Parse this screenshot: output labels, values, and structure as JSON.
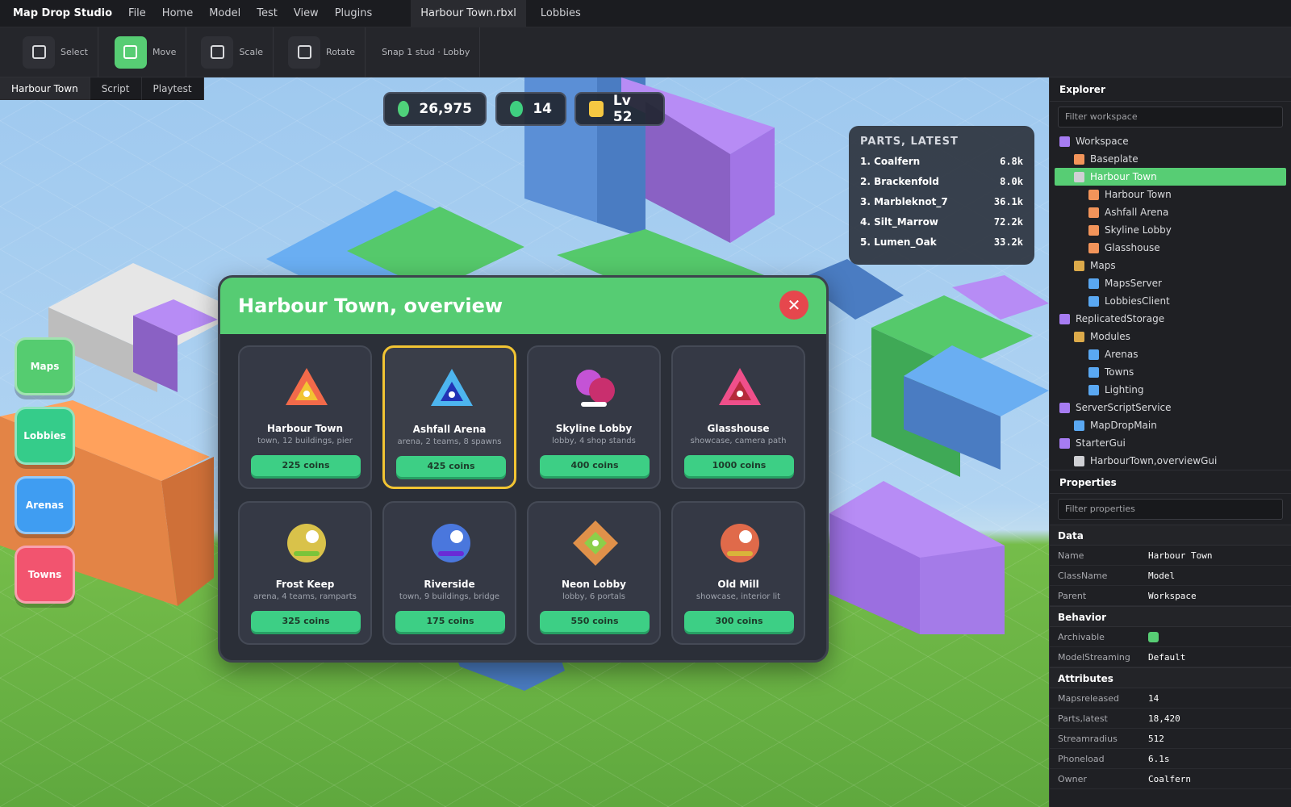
{
  "app": {
    "name": "Map Drop Studio",
    "menu": [
      "File",
      "Home",
      "Model",
      "Test",
      "View",
      "Plugins"
    ],
    "document_tab": "Harbour Town.rbxl",
    "second_tab": "Lobbies"
  },
  "toolbar": {
    "tools": [
      {
        "label": "Select",
        "active": false
      },
      {
        "label": "Move",
        "active": true
      },
      {
        "label": "Scale",
        "active": false
      },
      {
        "label": "Rotate",
        "active": false
      }
    ],
    "snap": "Snap 1 stud · Lobby"
  },
  "viewport": {
    "tabs": [
      "Harbour Town",
      "Script",
      "Playtest"
    ],
    "stats": [
      {
        "value": "26,975",
        "color": "#4fd17a"
      },
      {
        "value": "14",
        "color": "#3fcf80"
      },
      {
        "value": "Lv 52",
        "color": "#f5c842"
      }
    ],
    "leaderboard": {
      "title": "PARTS, LATEST",
      "rows": [
        {
          "name": "1. Coalfern",
          "value": "6.8k"
        },
        {
          "name": "2. Brackenfold",
          "value": "8.0k"
        },
        {
          "name": "3. Marbleknot_7",
          "value": "36.1k"
        },
        {
          "name": "4. Silt_Marrow",
          "value": "72.2k"
        },
        {
          "name": "5. Lumen_Oak",
          "value": "33.2k"
        }
      ]
    },
    "side_buttons": [
      {
        "label": "Maps",
        "color": "#55cc70"
      },
      {
        "label": "Lobbies",
        "color": "#35cc8a"
      },
      {
        "label": "Arenas",
        "color": "#3f9df2"
      },
      {
        "label": "Towns",
        "color": "#f2546f"
      }
    ]
  },
  "modal": {
    "title": "Harbour Town, overview",
    "close_icon": "close-icon",
    "cards": [
      {
        "name": "Harbour Town",
        "desc": "town, 12 buildings, pier",
        "price": "225 coins",
        "icon": "triangle-icon"
      },
      {
        "name": "Ashfall Arena",
        "desc": "arena, 2 teams, 8 spawns",
        "price": "425 coins",
        "icon": "triangle-icon",
        "selected": true
      },
      {
        "name": "Skyline Lobby",
        "desc": "lobby, 4 shop stands",
        "price": "400 coins",
        "icon": "orbs-icon"
      },
      {
        "name": "Glasshouse",
        "desc": "showcase, camera path",
        "price": "1000 coins",
        "icon": "triangle-icon"
      },
      {
        "name": "Frost Keep",
        "desc": "arena, 4 teams, ramparts",
        "price": "325 coins",
        "icon": "orb-icon"
      },
      {
        "name": "Riverside",
        "desc": "town, 9 buildings, bridge",
        "price": "175 coins",
        "icon": "orb-icon"
      },
      {
        "name": "Neon Lobby",
        "desc": "lobby, 6 portals",
        "price": "550 coins",
        "icon": "diamond-icon"
      },
      {
        "name": "Old Mill",
        "desc": "showcase, interior lit",
        "price": "300 coins",
        "icon": "orb-icon"
      }
    ]
  },
  "explorer": {
    "title": "Explorer",
    "filter_placeholder": "Filter workspace",
    "items": [
      {
        "label": "Workspace",
        "depth": 0,
        "color": "#a67cf2"
      },
      {
        "label": "Baseplate",
        "depth": 1,
        "color": "#f2945a"
      },
      {
        "label": "Harbour Town",
        "depth": 1,
        "color": "#cfd0d4",
        "selected": true
      },
      {
        "label": "Harbour Town",
        "depth": 2,
        "color": "#f2945a"
      },
      {
        "label": "Ashfall Arena",
        "depth": 2,
        "color": "#f2945a"
      },
      {
        "label": "Skyline Lobby",
        "depth": 2,
        "color": "#f2945a"
      },
      {
        "label": "Glasshouse",
        "depth": 2,
        "color": "#f2945a"
      },
      {
        "label": "Maps",
        "depth": 1,
        "color": "#dcaa4a"
      },
      {
        "label": "MapsServer",
        "depth": 2,
        "color": "#5aa8f2"
      },
      {
        "label": "LobbiesClient",
        "depth": 2,
        "color": "#5aa8f2"
      },
      {
        "label": "ReplicatedStorage",
        "depth": 0,
        "color": "#a67cf2"
      },
      {
        "label": "Modules",
        "depth": 1,
        "color": "#dcaa4a"
      },
      {
        "label": "Arenas",
        "depth": 2,
        "color": "#5aa8f2"
      },
      {
        "label": "Towns",
        "depth": 2,
        "color": "#5aa8f2"
      },
      {
        "label": "Lighting",
        "depth": 2,
        "color": "#5aa8f2"
      },
      {
        "label": "ServerScriptService",
        "depth": 0,
        "color": "#a67cf2"
      },
      {
        "label": "MapDropMain",
        "depth": 1,
        "color": "#5aa8f2"
      },
      {
        "label": "StarterGui",
        "depth": 0,
        "color": "#a67cf2"
      },
      {
        "label": "HarbourTown,overviewGui",
        "depth": 1,
        "color": "#cfd0d4"
      }
    ]
  },
  "properties": {
    "title": "Properties",
    "filter_placeholder": "Filter properties",
    "sections": [
      {
        "name": "Data",
        "rows": [
          {
            "k": "Name",
            "v": "Harbour Town"
          },
          {
            "k": "ClassName",
            "v": "Model"
          },
          {
            "k": "Parent",
            "v": "Workspace"
          }
        ]
      },
      {
        "name": "Behavior",
        "rows": [
          {
            "k": "Archivable",
            "v": "",
            "checkbox": true
          },
          {
            "k": "ModelStreaming",
            "v": "Default"
          }
        ]
      },
      {
        "name": "Attributes",
        "rows": [
          {
            "k": "Mapsreleased",
            "v": "14"
          },
          {
            "k": "Parts,latest",
            "v": "18,420"
          },
          {
            "k": "Streamradius",
            "v": "512"
          },
          {
            "k": "Phoneload",
            "v": "6.1s"
          },
          {
            "k": "Owner",
            "v": "Coalfern"
          }
        ]
      }
    ]
  }
}
